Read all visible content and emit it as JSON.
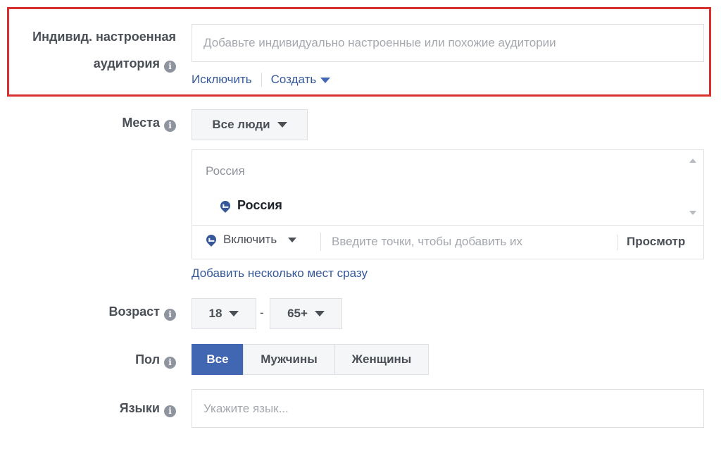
{
  "audience": {
    "label_line1": "Индивид. настроенная",
    "label_line2": "аудитория",
    "placeholder": "Добавьте индивидуально настроенные или похожие аудитории",
    "exclude_link": "Исключить",
    "create_link": "Создать"
  },
  "places": {
    "label": "Места",
    "dropdown_value": "Все люди",
    "group_title": "Россия",
    "selected_location": "Россия",
    "include_label": "Включить",
    "search_placeholder": "Введите точки, чтобы добавить их",
    "browse_label": "Просмотр",
    "bulk_add_link": "Добавить несколько мест сразу"
  },
  "age": {
    "label": "Возраст",
    "min": "18",
    "separator": "-",
    "max": "65+"
  },
  "gender": {
    "label": "Пол",
    "options": [
      "Все",
      "Мужчины",
      "Женщины"
    ],
    "selected": "Все"
  },
  "languages": {
    "label": "Языки",
    "placeholder": "Укажите язык..."
  },
  "colors": {
    "accent": "#4267b2",
    "link": "#365899",
    "highlight_border": "#d7302f",
    "label_text": "#4b4f56",
    "placeholder_text": "#a4a8ae"
  },
  "icons": {
    "info": "info-icon",
    "location": "location-pin-icon",
    "dropdown": "caret-down-icon"
  }
}
